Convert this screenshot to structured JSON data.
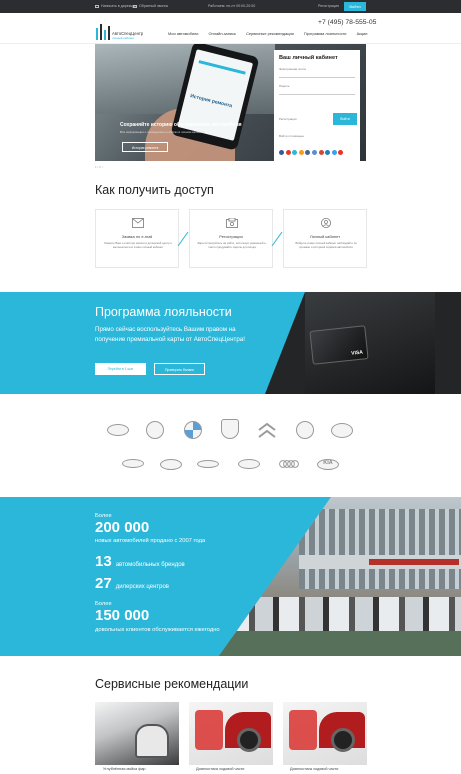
{
  "topbar": {
    "feedback": "Написать в дирекцию",
    "support": "Обратный звонок",
    "work_time": "Работаем: пн-пт 09:00-20:00",
    "register": "Регистрация",
    "login": "Войти"
  },
  "header": {
    "logo_name": "АвтоСпецЦентр",
    "logo_tagline": "личный кабинет",
    "phone": "+7 (495) 78-555-05",
    "nav": [
      "Мои автомобили",
      "Онлайн-запись",
      "Сервисные рекомендации",
      "Программа лояльности",
      "Акции"
    ]
  },
  "hero": {
    "phone_title": "История ремонта",
    "caption": "Сохраняйте историю обслуживания автомобиля",
    "subcaption": "Вся информация о проведённых работах в личном кабинете",
    "button": "История ремонта",
    "dots": "1 / 3 >"
  },
  "cabinet": {
    "title": "Ваш личный кабинет",
    "login_label": "Электронная почта",
    "password_label": "Пароль",
    "register_link": "Регистрация",
    "submit": "Войти",
    "social_label": "Войти с помощью",
    "social_colors": [
      "#3b5998",
      "#e23c27",
      "#2ab7d9",
      "#f79a1d",
      "#45668e",
      "#5a8dd6",
      "#d34836",
      "#1e7fc1",
      "#38a1f3",
      "#ef3124"
    ]
  },
  "access": {
    "title": "Как получить доступ",
    "cards": [
      {
        "icon": "mail-icon",
        "title": "Заявка по e-mail",
        "desc": "Укажите Ваш e-mail при записи в дилерский центр и мы вышлем его в ваш личный кабинет"
      },
      {
        "icon": "registration-icon",
        "title": "Регистрация",
        "desc": "Зарегистрируйтесь на сайте, используя указанный e-mail и придумайте пароль для входа"
      },
      {
        "icon": "user-icon",
        "title": "Личный кабинет",
        "desc": "Войдите в ваш личный кабинет наблюдайте за сроками и историей сервиса автомобиля"
      }
    ]
  },
  "loyalty": {
    "title": "Программа лояльности",
    "text": "Прямо сейчас воспользуйтесь Вашим правом на получение премиальной карты от АвтоСпецЦентра!",
    "btn_primary": "Перейти в 1 шаг",
    "btn_secondary": "Проверить баланс",
    "card_brand": "VISA"
  },
  "brands": {
    "row1": [
      "nissan-icon",
      "volkswagen-icon",
      "bmw-icon",
      "porsche-icon",
      "citroen-icon",
      "skoda-icon",
      "mazda-icon"
    ],
    "row2_labels": [
      "",
      "",
      "",
      "",
      "",
      "KIA"
    ],
    "row2": [
      "jaguar-icon",
      "hyundai-icon",
      "mini-icon",
      "infiniti-icon",
      "audi-icon",
      "kia-icon"
    ]
  },
  "stats": {
    "s1_pre": "Более",
    "s1_num": "200 000",
    "s1_post": "новых автомобилей продано с 2007 года",
    "s2_num": "13",
    "s2_post": "автомобильных брендов",
    "s3_num": "27",
    "s3_post": "дилерских центров",
    "s4_pre": "Более",
    "s4_num": "150 000",
    "s4_post": "довольных клиентов обслуживается ежегодно"
  },
  "recommendations": {
    "title": "Сервисные рекомендации",
    "items": [
      "Углублённая мойка фар",
      "Диагностика ходовой части",
      "Диагностика ходовой части"
    ]
  }
}
